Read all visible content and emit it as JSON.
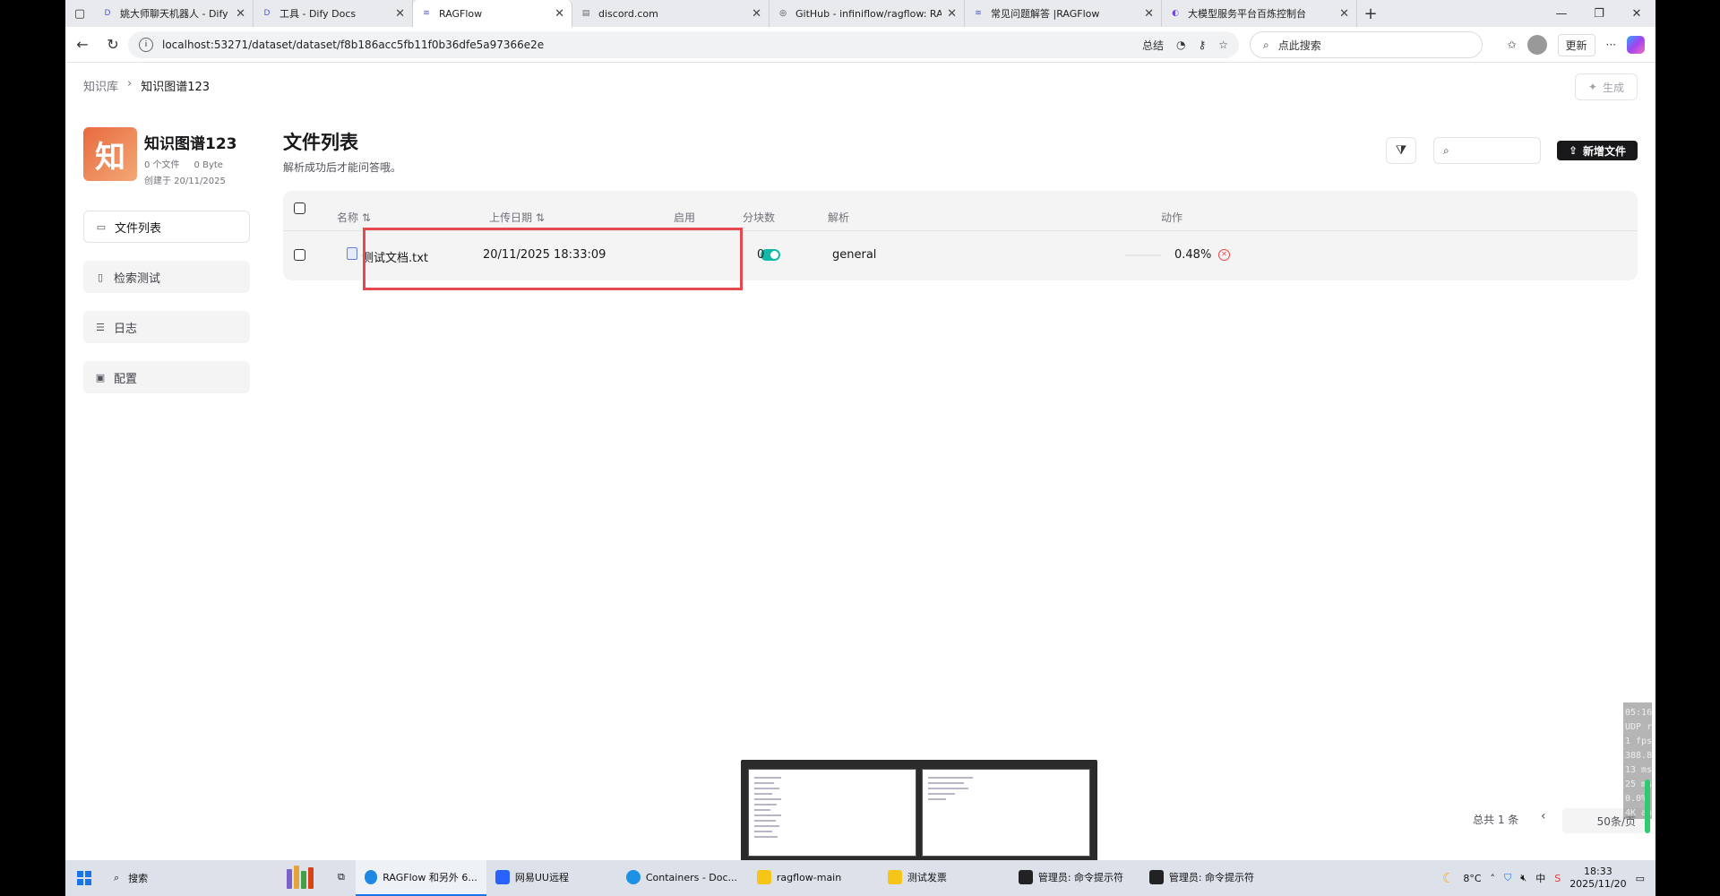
{
  "browser": {
    "tabs": [
      {
        "title": "姚大师聊天机器人 - Dify",
        "active": false
      },
      {
        "title": "工具 - Dify Docs",
        "active": false
      },
      {
        "title": "RAGFlow",
        "active": true
      },
      {
        "title": "discord.com",
        "active": false
      },
      {
        "title": "GitHub - infiniflow/ragflow: RAGF",
        "active": false
      },
      {
        "title": "常见问题解答 |RAGFlow",
        "active": false
      },
      {
        "title": "大模型服务平台百炼控制台",
        "active": false
      }
    ],
    "url": "localhost:53271/dataset/dataset/f8b186acc5fb11f0b36dfe5a97366e2e",
    "url_summary": "总结",
    "search_placeholder": "点此搜索",
    "update_label": "更新"
  },
  "page": {
    "breadcrumb": {
      "root": "知识库",
      "current": "知识图谱123"
    },
    "generate_label": "生成",
    "dataset": {
      "logo_char": "知",
      "name": "知识图谱123",
      "file_count": "0 个文件",
      "size": "0 Byte",
      "created": "创建于 20/11/2025"
    },
    "sidebar": [
      {
        "label": "文件列表",
        "icon": "folder-icon",
        "active": true
      },
      {
        "label": "检索测试",
        "icon": "file-search-icon",
        "active": false
      },
      {
        "label": "日志",
        "icon": "list-icon",
        "active": false
      },
      {
        "label": "配置",
        "icon": "settings-icon",
        "active": false
      }
    ],
    "main": {
      "title": "文件列表",
      "subtitle": "解析成功后才能问答哦。",
      "add_file_label": "新增文件"
    },
    "table": {
      "headers": {
        "name": "名称",
        "upload_date": "上传日期",
        "enabled": "启用",
        "chunks": "分块数",
        "parse": "解析",
        "action": "动作"
      },
      "rows": [
        {
          "name": "测试文档.txt",
          "upload_date": "20/11/2025 18:33:09",
          "enabled": true,
          "chunks": "0",
          "parser": "general",
          "progress": "0.48%"
        }
      ]
    },
    "pagination": {
      "total": "总共 1 条",
      "page": "1",
      "page_size": "50条/页"
    }
  },
  "overlay": {
    "stats": [
      "05:16:55",
      "UDP relay",
      "1 fps",
      "388.8 Kbps",
      "13 ms",
      "25 ms frm.",
      "0.0% loss",
      "4K auto"
    ]
  },
  "taskbar": {
    "search_label": "搜索",
    "items": [
      {
        "label": "RAGFlow 和另外 6...",
        "active": true,
        "color": "#1e88e5"
      },
      {
        "label": "网易UU远程",
        "active": false,
        "color": "#2962ff"
      },
      {
        "label": "Containers - Doc...",
        "active": false,
        "color": "#1d91e6"
      },
      {
        "label": "ragflow-main",
        "active": false,
        "color": "#f5c518"
      },
      {
        "label": "测试发票",
        "active": false,
        "color": "#f5c518"
      },
      {
        "label": "管理员: 命令提示符",
        "active": false,
        "color": "#222222"
      },
      {
        "label": "管理员: 命令提示符",
        "active": false,
        "color": "#222222"
      }
    ],
    "weather": "8°C",
    "ime": "中",
    "time": "18:33",
    "date": "2025/11/20"
  }
}
